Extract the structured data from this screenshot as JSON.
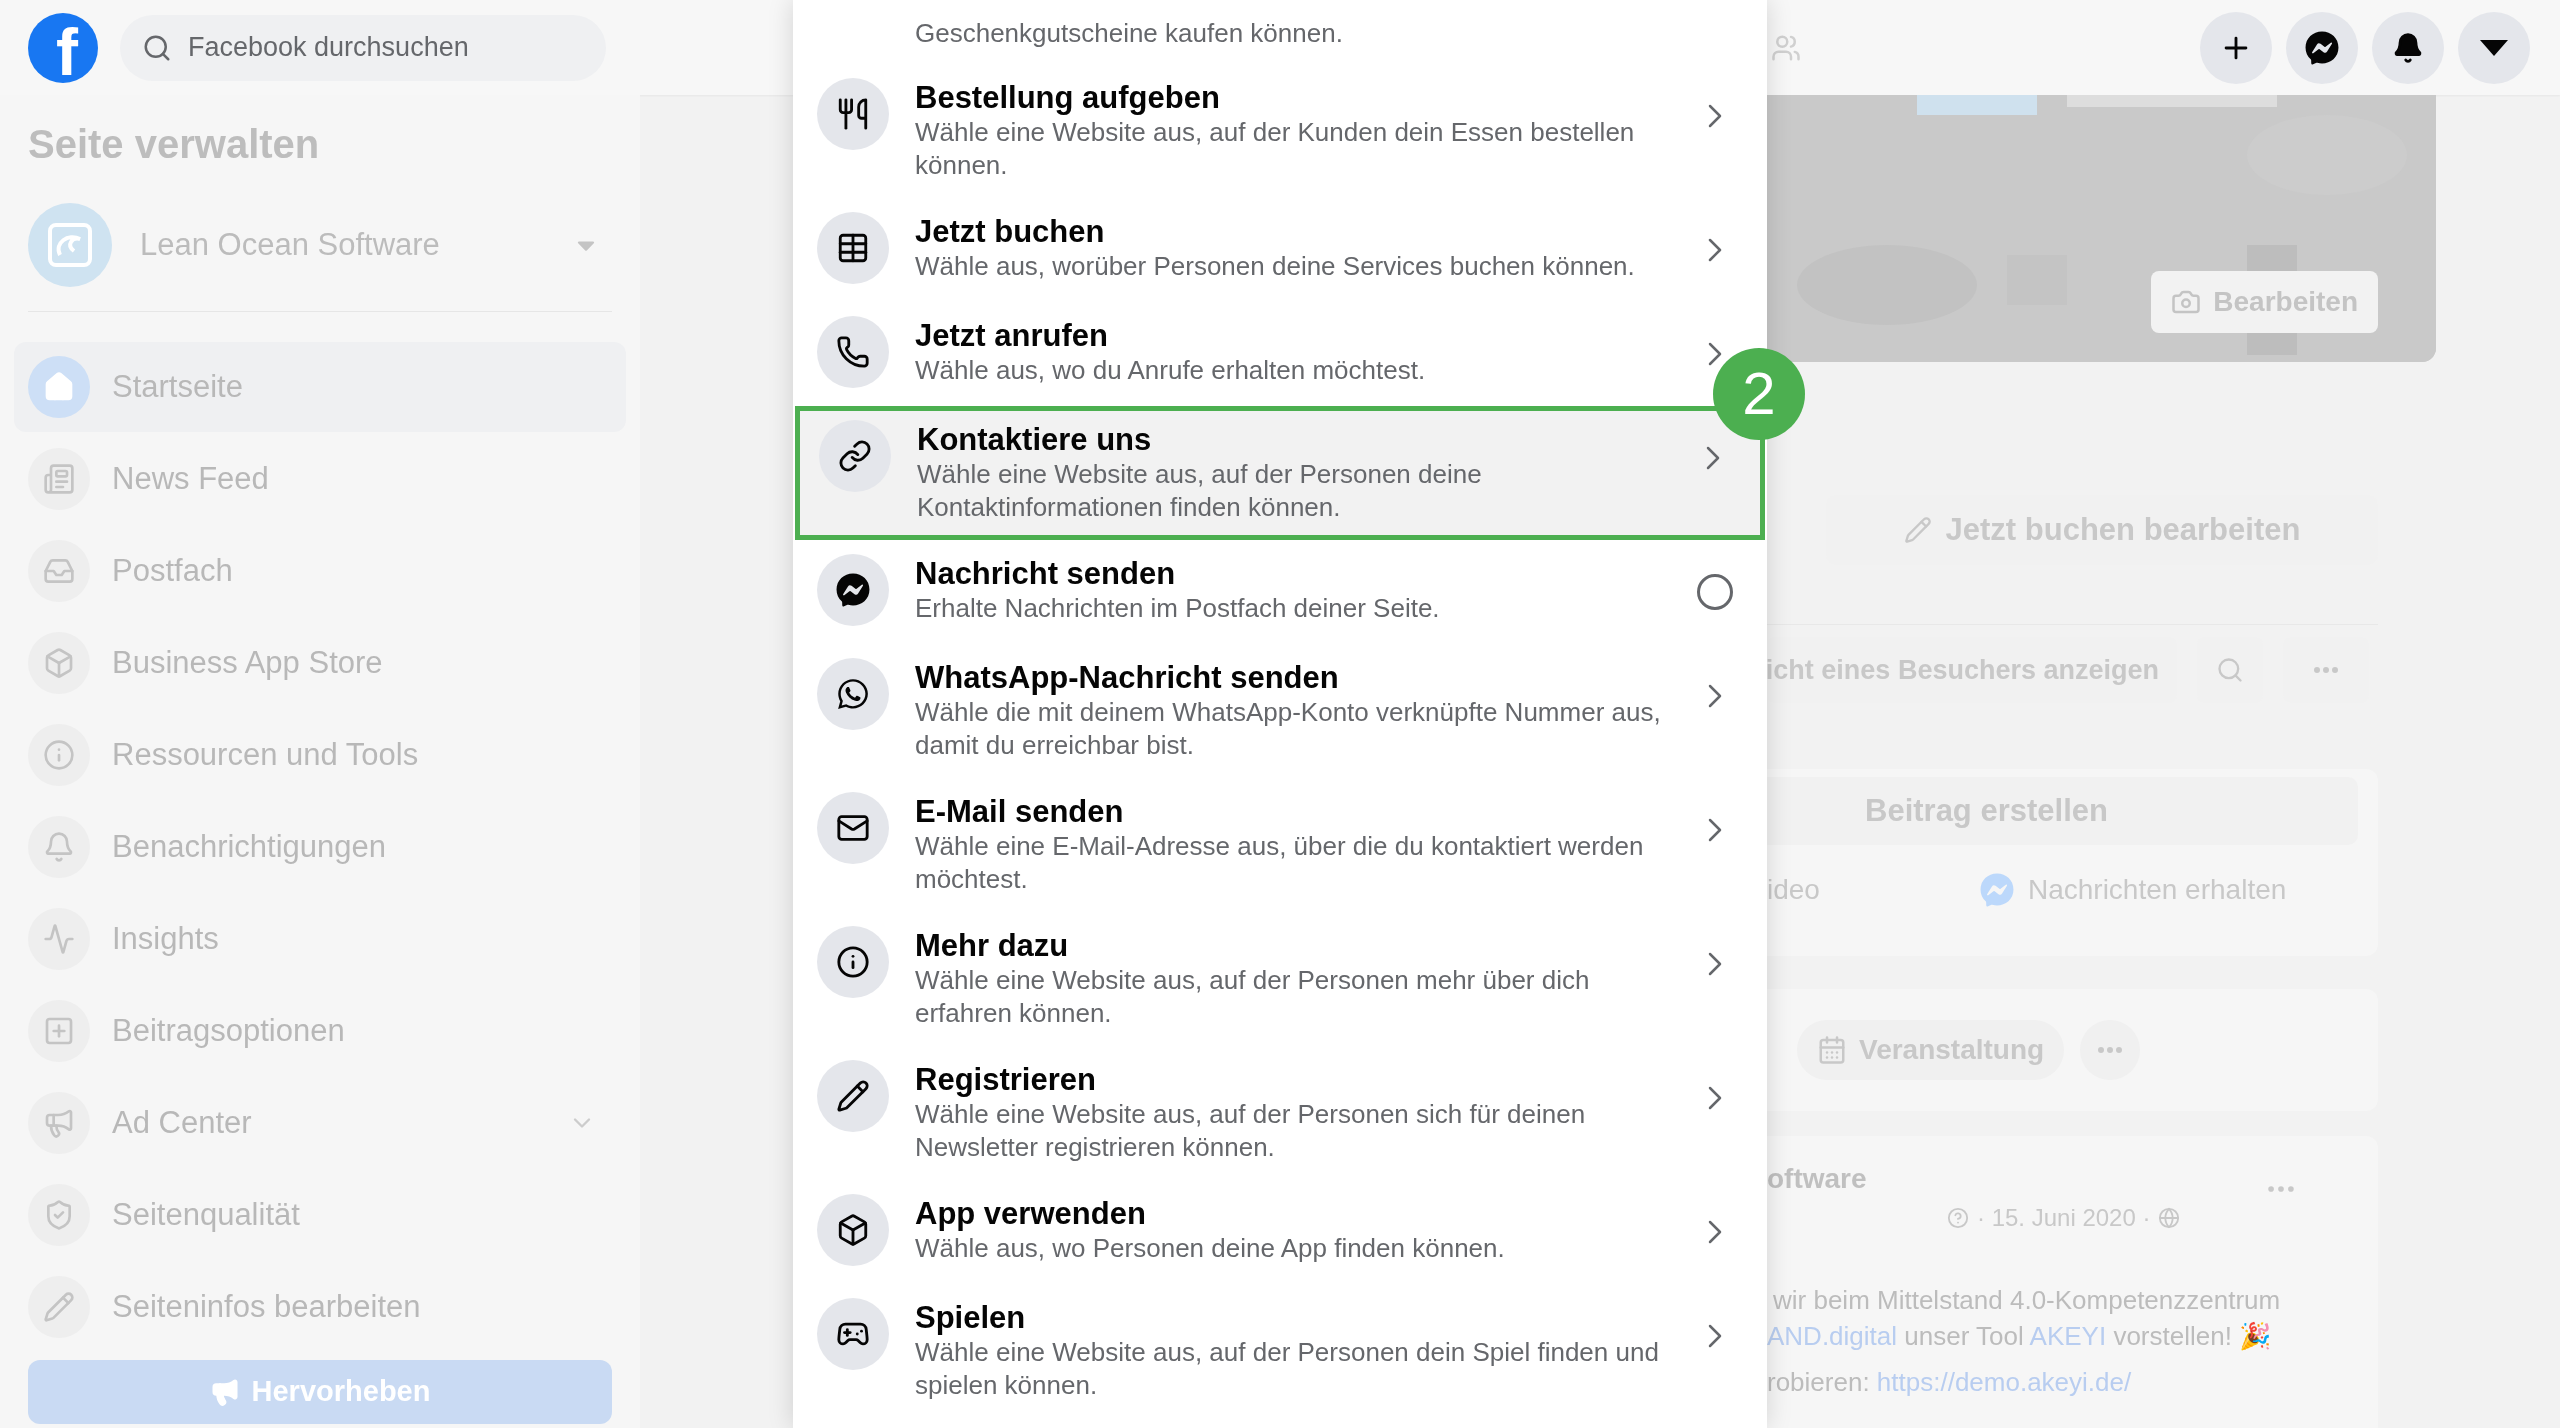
{
  "topbar": {
    "logo": {
      "letter": "f"
    },
    "search": {
      "placeholder": "Facebook durchsuchen"
    }
  },
  "sidebar": {
    "title": "Seite verwalten",
    "page_name": "Lean Ocean Software",
    "items": [
      {
        "label": "Startseite",
        "selected": true
      },
      {
        "label": "News Feed",
        "selected": false
      },
      {
        "label": "Postfach",
        "selected": false
      },
      {
        "label": "Business App Store",
        "selected": false
      },
      {
        "label": "Ressourcen und Tools",
        "selected": false
      },
      {
        "label": "Benachrichtigungen",
        "selected": false
      },
      {
        "label": "Insights",
        "selected": false
      },
      {
        "label": "Beitragsoptionen",
        "selected": false
      },
      {
        "label": "Ad Center",
        "selected": false,
        "expandable": true
      },
      {
        "label": "Seitenqualität",
        "selected": false
      },
      {
        "label": "Seiteninfos bearbeiten",
        "selected": false
      }
    ],
    "promote_button": "Hervorheben"
  },
  "page": {
    "cover_button": "Bearbeiten",
    "cta_button": "Jetzt buchen bearbeiten",
    "visitor_view_button": "icht eines Besuchers anzeigen",
    "composer": {
      "placeholder": "Beitrag erstellen",
      "actions": [
        "ideo",
        "Nachrichten erhalten"
      ]
    },
    "event_button": "Veranstaltung",
    "post": {
      "author": "oftware",
      "date": "· 15. Juni 2020 ·",
      "lines": [
        "wir beim Mittelstand 4.0-Kompetenzzentrum"
      ],
      "line_2": {
        "link_1": "AND.digital",
        "text_1": " unser Tool ",
        "link_2": "AKEYI",
        "text_2": " vorstellen! 🎉"
      },
      "line_3": {
        "text": "robieren: ",
        "link": "https://demo.akeyi.de/"
      }
    }
  },
  "menu": {
    "cut_description": "Geschenkgutscheine kaufen können.",
    "items": [
      {
        "title": "Bestellung aufgeben",
        "description": "Wähle eine Website aus, auf der Kunden dein Essen bestellen können.",
        "kind": "chevron",
        "highlighted": false
      },
      {
        "title": "Jetzt buchen",
        "description": "Wähle aus, worüber Personen deine Services buchen können.",
        "kind": "chevron",
        "highlighted": false
      },
      {
        "title": "Jetzt anrufen",
        "description": "Wähle aus, wo du Anrufe erhalten möchtest.",
        "kind": "chevron",
        "highlighted": false
      },
      {
        "title": "Kontaktiere uns",
        "description": "Wähle eine Website aus, auf der Personen deine Kontaktinformationen finden können.",
        "kind": "chevron",
        "highlighted": true
      },
      {
        "title": "Nachricht senden",
        "description": "Erhalte Nachrichten im Postfach deiner Seite.",
        "kind": "radio",
        "selected": false,
        "highlighted": false
      },
      {
        "title": "WhatsApp-Nachricht senden",
        "description": "Wähle die mit deinem WhatsApp-Konto verknüpfte Nummer aus, damit du erreichbar bist.",
        "kind": "chevron",
        "highlighted": false
      },
      {
        "title": "E-Mail senden",
        "description": "Wähle eine E-Mail-Adresse aus, über die du kontaktiert werden möchtest.",
        "kind": "chevron",
        "highlighted": false
      },
      {
        "title": "Mehr dazu",
        "description": "Wähle eine Website aus, auf der Personen mehr über dich erfahren können.",
        "kind": "chevron",
        "highlighted": false
      },
      {
        "title": "Registrieren",
        "description": "Wähle eine Website aus, auf der Personen sich für deinen Newsletter registrieren können.",
        "kind": "chevron",
        "highlighted": false
      },
      {
        "title": "App verwenden",
        "description": "Wähle aus, wo Personen deine App finden können.",
        "kind": "chevron",
        "highlighted": false
      },
      {
        "title": "Spielen",
        "description": "Wähle eine Website aus, auf der Personen dein Spiel finden und spielen können.",
        "kind": "chevron",
        "highlighted": false
      }
    ]
  },
  "annotation": {
    "label": "2"
  }
}
